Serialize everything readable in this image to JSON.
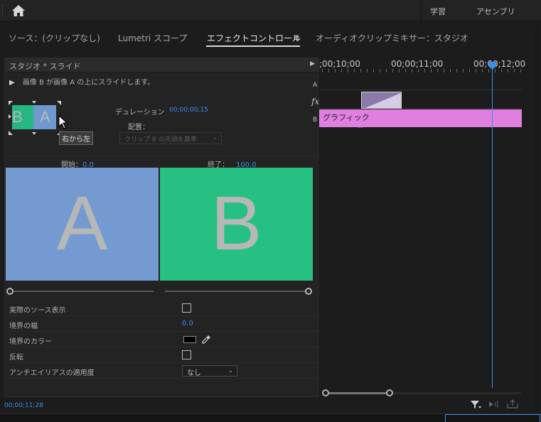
{
  "top": {
    "workspaces": [
      "学習",
      "アセンブリ"
    ]
  },
  "panel_tabs": {
    "source": "ソース：(クリップなし)",
    "lumetri": "Lumetri スコープ",
    "effect_controls": "エフェクトコントロール",
    "audio_mixer": "オーディオクリップミキサー：スタジオ"
  },
  "effect": {
    "title": "スタジオ * スライド",
    "description": "画像 B が画像 A の上にスライドします。",
    "thumb_letters": {
      "a": "A",
      "b": "B"
    },
    "tooltip": "右から左",
    "duration_label": "デュレーション",
    "duration_value": "00;00;00;15",
    "placement_label": "配置：",
    "placement_value": "クリップ B の先頭を基準",
    "start_label": "開始：",
    "start_value": "0.0",
    "end_label": "終了：",
    "end_value": "100.0",
    "preview_a": "A",
    "preview_b": "B",
    "props": {
      "show_source": "実際のソース表示",
      "border_width": "境界の幅",
      "border_width_value": "0.0",
      "border_color": "境界のカラー",
      "border_color_hex": "#000000",
      "reverse": "反転",
      "antialias": "アンチエイリアスの適用度",
      "antialias_value": "なし"
    },
    "timecode": "00;00;11;28"
  },
  "timeline": {
    "ticks": [
      ";00;10;00",
      "00;00;11;00",
      "00;00;12;00"
    ],
    "track_a": "A",
    "track_fx": "fx",
    "track_b": "B",
    "clip_label": "グラフィック"
  },
  "colors": {
    "accent": "#3b8de8",
    "clip_pink": "#e07fe0",
    "preview_a": "#739bd1",
    "preview_b": "#26c083"
  }
}
